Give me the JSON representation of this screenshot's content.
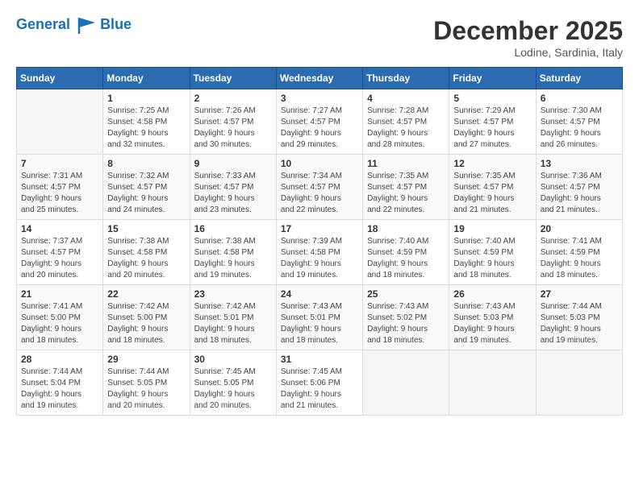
{
  "header": {
    "logo_line1": "General",
    "logo_line2": "Blue",
    "month": "December 2025",
    "location": "Lodine, Sardinia, Italy"
  },
  "weekdays": [
    "Sunday",
    "Monday",
    "Tuesday",
    "Wednesday",
    "Thursday",
    "Friday",
    "Saturday"
  ],
  "weeks": [
    [
      {
        "day": "",
        "info": ""
      },
      {
        "day": "1",
        "info": "Sunrise: 7:25 AM\nSunset: 4:58 PM\nDaylight: 9 hours\nand 32 minutes."
      },
      {
        "day": "2",
        "info": "Sunrise: 7:26 AM\nSunset: 4:57 PM\nDaylight: 9 hours\nand 30 minutes."
      },
      {
        "day": "3",
        "info": "Sunrise: 7:27 AM\nSunset: 4:57 PM\nDaylight: 9 hours\nand 29 minutes."
      },
      {
        "day": "4",
        "info": "Sunrise: 7:28 AM\nSunset: 4:57 PM\nDaylight: 9 hours\nand 28 minutes."
      },
      {
        "day": "5",
        "info": "Sunrise: 7:29 AM\nSunset: 4:57 PM\nDaylight: 9 hours\nand 27 minutes."
      },
      {
        "day": "6",
        "info": "Sunrise: 7:30 AM\nSunset: 4:57 PM\nDaylight: 9 hours\nand 26 minutes."
      }
    ],
    [
      {
        "day": "7",
        "info": "Sunrise: 7:31 AM\nSunset: 4:57 PM\nDaylight: 9 hours\nand 25 minutes."
      },
      {
        "day": "8",
        "info": "Sunrise: 7:32 AM\nSunset: 4:57 PM\nDaylight: 9 hours\nand 24 minutes."
      },
      {
        "day": "9",
        "info": "Sunrise: 7:33 AM\nSunset: 4:57 PM\nDaylight: 9 hours\nand 23 minutes."
      },
      {
        "day": "10",
        "info": "Sunrise: 7:34 AM\nSunset: 4:57 PM\nDaylight: 9 hours\nand 22 minutes."
      },
      {
        "day": "11",
        "info": "Sunrise: 7:35 AM\nSunset: 4:57 PM\nDaylight: 9 hours\nand 22 minutes."
      },
      {
        "day": "12",
        "info": "Sunrise: 7:35 AM\nSunset: 4:57 PM\nDaylight: 9 hours\nand 21 minutes."
      },
      {
        "day": "13",
        "info": "Sunrise: 7:36 AM\nSunset: 4:57 PM\nDaylight: 9 hours\nand 21 minutes."
      }
    ],
    [
      {
        "day": "14",
        "info": "Sunrise: 7:37 AM\nSunset: 4:57 PM\nDaylight: 9 hours\nand 20 minutes."
      },
      {
        "day": "15",
        "info": "Sunrise: 7:38 AM\nSunset: 4:58 PM\nDaylight: 9 hours\nand 20 minutes."
      },
      {
        "day": "16",
        "info": "Sunrise: 7:38 AM\nSunset: 4:58 PM\nDaylight: 9 hours\nand 19 minutes."
      },
      {
        "day": "17",
        "info": "Sunrise: 7:39 AM\nSunset: 4:58 PM\nDaylight: 9 hours\nand 19 minutes."
      },
      {
        "day": "18",
        "info": "Sunrise: 7:40 AM\nSunset: 4:59 PM\nDaylight: 9 hours\nand 18 minutes."
      },
      {
        "day": "19",
        "info": "Sunrise: 7:40 AM\nSunset: 4:59 PM\nDaylight: 9 hours\nand 18 minutes."
      },
      {
        "day": "20",
        "info": "Sunrise: 7:41 AM\nSunset: 4:59 PM\nDaylight: 9 hours\nand 18 minutes."
      }
    ],
    [
      {
        "day": "21",
        "info": "Sunrise: 7:41 AM\nSunset: 5:00 PM\nDaylight: 9 hours\nand 18 minutes."
      },
      {
        "day": "22",
        "info": "Sunrise: 7:42 AM\nSunset: 5:00 PM\nDaylight: 9 hours\nand 18 minutes."
      },
      {
        "day": "23",
        "info": "Sunrise: 7:42 AM\nSunset: 5:01 PM\nDaylight: 9 hours\nand 18 minutes."
      },
      {
        "day": "24",
        "info": "Sunrise: 7:43 AM\nSunset: 5:01 PM\nDaylight: 9 hours\nand 18 minutes."
      },
      {
        "day": "25",
        "info": "Sunrise: 7:43 AM\nSunset: 5:02 PM\nDaylight: 9 hours\nand 18 minutes."
      },
      {
        "day": "26",
        "info": "Sunrise: 7:43 AM\nSunset: 5:03 PM\nDaylight: 9 hours\nand 19 minutes."
      },
      {
        "day": "27",
        "info": "Sunrise: 7:44 AM\nSunset: 5:03 PM\nDaylight: 9 hours\nand 19 minutes."
      }
    ],
    [
      {
        "day": "28",
        "info": "Sunrise: 7:44 AM\nSunset: 5:04 PM\nDaylight: 9 hours\nand 19 minutes."
      },
      {
        "day": "29",
        "info": "Sunrise: 7:44 AM\nSunset: 5:05 PM\nDaylight: 9 hours\nand 20 minutes."
      },
      {
        "day": "30",
        "info": "Sunrise: 7:45 AM\nSunset: 5:05 PM\nDaylight: 9 hours\nand 20 minutes."
      },
      {
        "day": "31",
        "info": "Sunrise: 7:45 AM\nSunset: 5:06 PM\nDaylight: 9 hours\nand 21 minutes."
      },
      {
        "day": "",
        "info": ""
      },
      {
        "day": "",
        "info": ""
      },
      {
        "day": "",
        "info": ""
      }
    ]
  ]
}
